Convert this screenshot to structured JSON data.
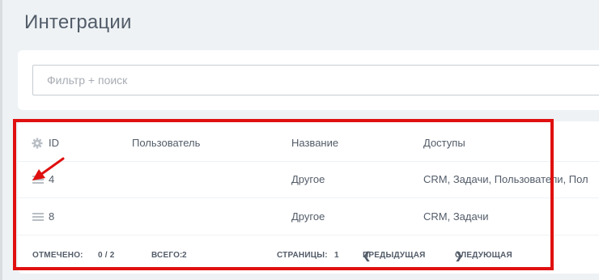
{
  "page": {
    "title": "Интеграции"
  },
  "filter": {
    "placeholder": "Фильтр + поиск"
  },
  "grid": {
    "columns": {
      "id": "ID",
      "user": "Пользователь",
      "name": "Название",
      "access": "Доступы"
    },
    "rows": [
      {
        "id": "4",
        "user": "",
        "name": "Другое",
        "access": "CRM, Задачи, Пользователи, Пол"
      },
      {
        "id": "8",
        "user": "",
        "name": "Другое",
        "access": "CRM, Задачи"
      }
    ]
  },
  "footer": {
    "checked_label": "ОТМЕЧЕНО:",
    "checked_value": "0 / 2",
    "total_label": "ВСЕГО:",
    "total_value": "2",
    "pages_label": "СТРАНИЦЫ:",
    "pages_value": "1",
    "prev_label": "ПРЕДЫДУЩАЯ",
    "next_label": "СЛЕДУЮЩАЯ"
  },
  "annotation": {
    "highlight_color": "#e01010",
    "icons": [
      "gear-icon",
      "drag-handle-icon",
      "chevron-left-icon",
      "chevron-right-icon"
    ]
  }
}
